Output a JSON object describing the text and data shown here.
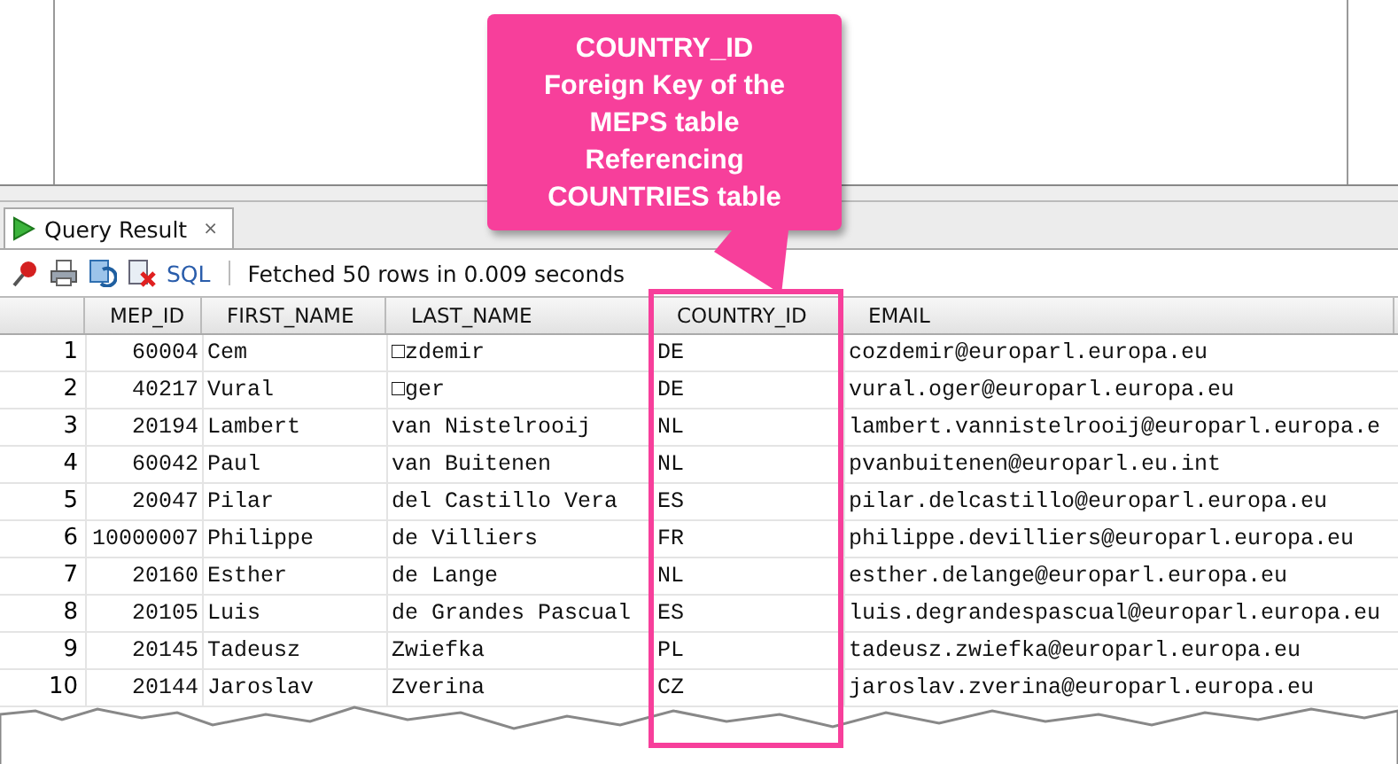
{
  "tab": {
    "label": "Query Result",
    "close": "×",
    "selected": true
  },
  "toolbar": {
    "sql": "SQL",
    "status": "Fetched 50 rows in 0.009 seconds"
  },
  "table": {
    "columns": [
      "MEP_ID",
      "FIRST_NAME",
      "LAST_NAME",
      "COUNTRY_ID",
      "EMAIL"
    ],
    "rows": [
      {
        "n": "1",
        "cells": [
          "60004",
          "Cem",
          "□zdemir",
          "DE",
          "cozdemir@europarl.europa.eu"
        ]
      },
      {
        "n": "2",
        "cells": [
          "40217",
          "Vural",
          "□ger",
          "DE",
          "vural.oger@europarl.europa.eu"
        ]
      },
      {
        "n": "3",
        "cells": [
          "20194",
          "Lambert",
          "van Nistelrooij",
          "NL",
          "lambert.vannistelrooij@europarl.europa.e"
        ]
      },
      {
        "n": "4",
        "cells": [
          "60042",
          "Paul",
          "van Buitenen",
          "NL",
          "pvanbuitenen@europarl.eu.int"
        ]
      },
      {
        "n": "5",
        "cells": [
          "20047",
          "Pilar",
          "del Castillo Vera",
          "ES",
          "pilar.delcastillo@europarl.europa.eu"
        ]
      },
      {
        "n": "6",
        "cells": [
          "10000007",
          "Philippe",
          "de Villiers",
          "FR",
          "philippe.devilliers@europarl.europa.eu"
        ]
      },
      {
        "n": "7",
        "cells": [
          "20160",
          "Esther",
          "de Lange",
          "NL",
          "esther.delange@europarl.europa.eu"
        ]
      },
      {
        "n": "8",
        "cells": [
          "20105",
          "Luis",
          "de Grandes Pascual",
          "ES",
          "luis.degrandespascual@europarl.europa.eu"
        ]
      },
      {
        "n": "9",
        "cells": [
          "20145",
          "Tadeusz",
          "Zwiefka",
          "PL",
          "tadeusz.zwiefka@europarl.europa.eu"
        ]
      },
      {
        "n": "10",
        "cells": [
          "20144",
          "Jaroslav",
          "Zverina",
          "CZ",
          "jaroslav.zverina@europarl.europa.eu"
        ]
      }
    ]
  },
  "callout": {
    "lines": [
      "COUNTRY_ID",
      "Foreign Key of the",
      "MEPS table",
      "Referencing",
      "COUNTRIES table"
    ]
  }
}
